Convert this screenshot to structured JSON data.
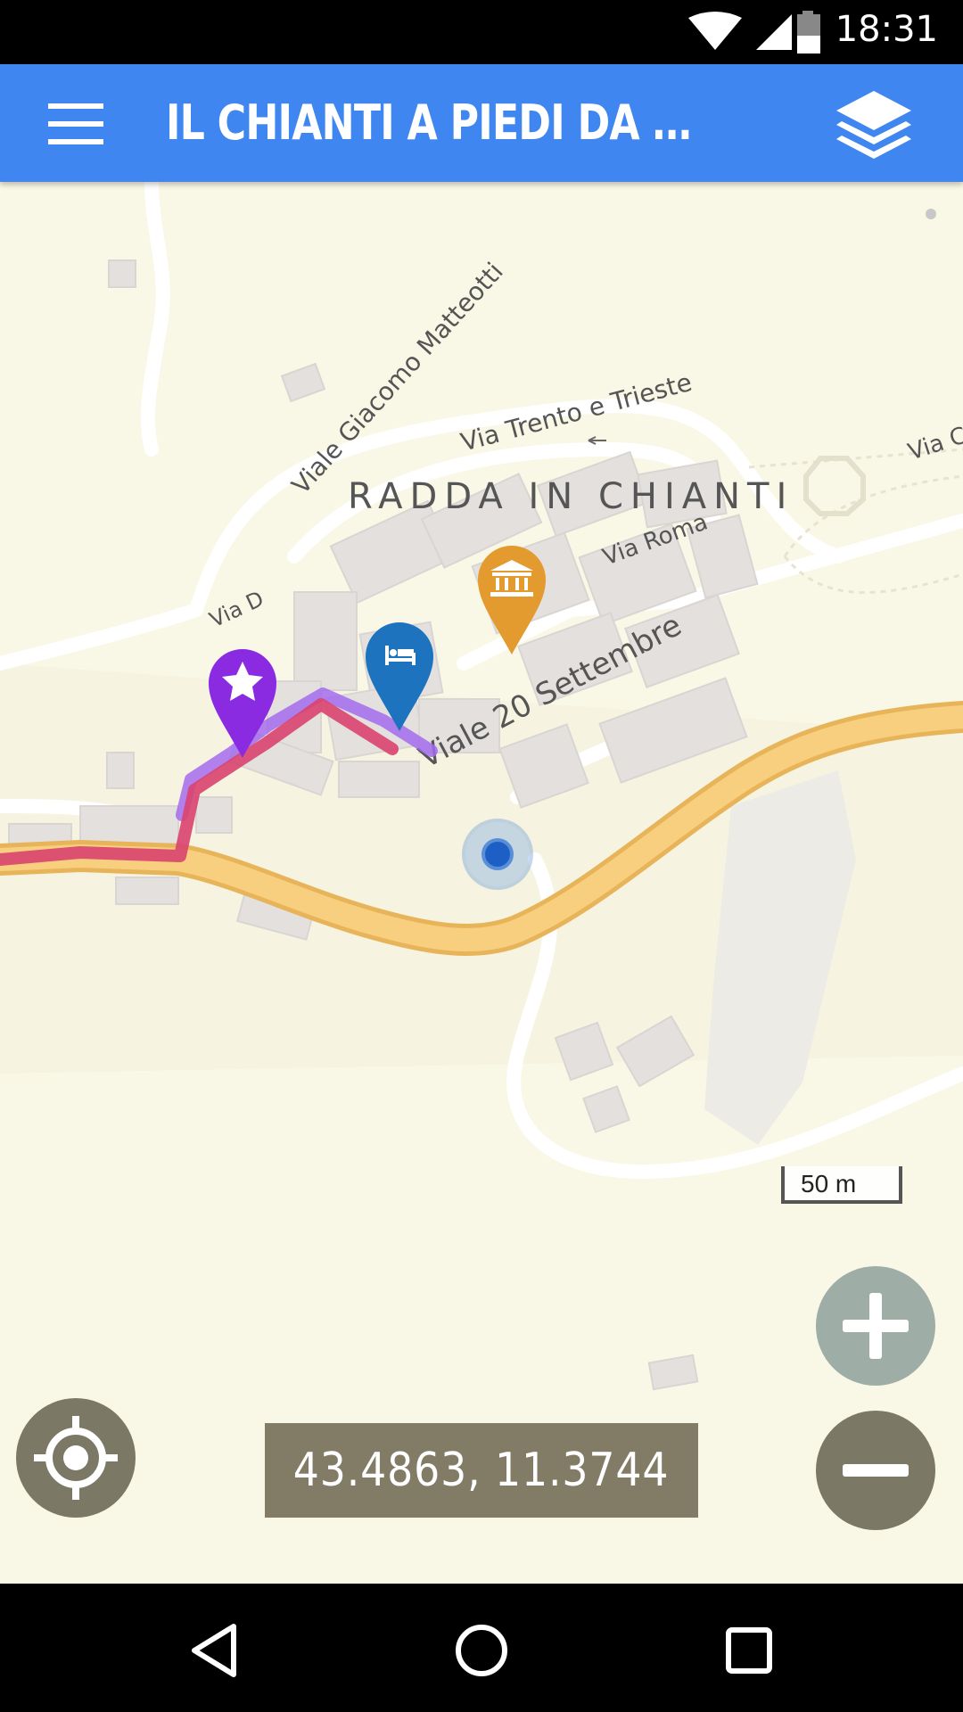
{
  "status_bar": {
    "time": "18:31",
    "icons": [
      "wifi-icon",
      "cell-signal-icon",
      "battery-icon"
    ]
  },
  "app_bar": {
    "title": "IL CHIANTI A PIEDI DA FIRE...",
    "color": "#3f86f0",
    "left_icon": "hamburger-menu-icon",
    "right_icon": "layers-icon"
  },
  "map": {
    "background_color": "#f9f8e6",
    "road_color": "#f6c56a",
    "labels": {
      "town": "RADDA IN CHIANTI",
      "street_matteotti": "Viale Giacomo Matteotti",
      "street_trento": "Via Trento e Trieste",
      "street_roma": "Via Roma",
      "street_settembre": "Viale 20 Settembre",
      "street_right": "Via C",
      "street_small": "Via D"
    },
    "markers": [
      {
        "name": "star-marker",
        "icon": "star-icon",
        "color": "#8a2be2"
      },
      {
        "name": "hotel-marker",
        "icon": "bed-icon",
        "color": "#1e73be"
      },
      {
        "name": "museum-marker",
        "icon": "museum-icon",
        "color": "#e39a2f"
      }
    ],
    "track_colors": {
      "main": "#d9426f",
      "secondary": "#a56bef"
    },
    "current_location_icon": "current-location-icon",
    "scale": "50 m"
  },
  "controls": {
    "zoom_in_icon": "plus-icon",
    "zoom_out_icon": "minus-icon",
    "locate_icon": "crosshair-icon",
    "coordinates": "43.4863, 11.3744"
  },
  "nav_bar": {
    "back_icon": "back-triangle-icon",
    "home_icon": "home-circle-icon",
    "recents_icon": "recents-square-icon"
  }
}
